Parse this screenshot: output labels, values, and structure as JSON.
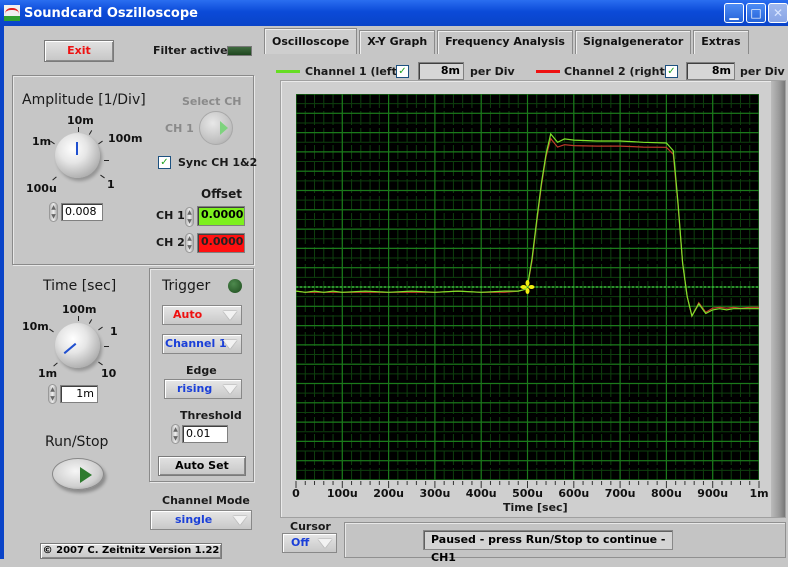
{
  "window": {
    "title": "Soundcard Oszilloscope",
    "controls": [
      "minimize",
      "maximize",
      "close"
    ]
  },
  "left_panel": {
    "exit_label": "Exit",
    "filter_active_label": "Filter active",
    "amplitude": {
      "title": "Amplitude [1/Div]",
      "knob_scale": [
        "100u",
        "1m",
        "10m",
        "100m",
        "1"
      ],
      "value": "0.008"
    },
    "select_ch": {
      "label": "Select CH",
      "value": "CH 1"
    },
    "sync_label": "Sync CH 1&2",
    "sync_checked": true,
    "offset": {
      "title": "Offset",
      "ch1_label": "CH 1",
      "ch1_value": "0.0000",
      "ch2_label": "CH 2",
      "ch2_value": "0.0000"
    },
    "time": {
      "title": "Time [sec]",
      "knob_scale": [
        "1m",
        "10m",
        "100m",
        "1",
        "10"
      ],
      "value": "1m"
    },
    "trigger": {
      "title": "Trigger",
      "mode": "Auto",
      "source": "Channel 1",
      "edge_label": "Edge",
      "edge": "rising",
      "threshold_label": "Threshold",
      "threshold": "0.01",
      "autoset_label": "Auto Set"
    },
    "run_stop_label": "Run/Stop",
    "channel_mode_label": "Channel Mode",
    "channel_mode": "single",
    "copyright": "© 2007   C. Zeitnitz Version 1.22"
  },
  "tabs": [
    {
      "label": "Oscilloscope",
      "active": true
    },
    {
      "label": "X-Y Graph",
      "active": false
    },
    {
      "label": "Frequency Analysis",
      "active": false
    },
    {
      "label": "Signalgenerator",
      "active": false
    },
    {
      "label": "Extras",
      "active": false
    }
  ],
  "channels": [
    {
      "name": "Channel 1 (left)",
      "color": "#66dd22",
      "enabled": true,
      "per_div": "8m",
      "per_div_label": "per Div"
    },
    {
      "name": "Channel 2 (right)",
      "color": "#ee1111",
      "enabled": true,
      "per_div": "8m",
      "per_div_label": "per Div"
    }
  ],
  "cursor": {
    "label": "Cursor",
    "value": "Off"
  },
  "status": "Paused - press Run/Stop to continue - CH1",
  "colors": {
    "plot_bg": "#000000",
    "grid_major": "#1b7a1b",
    "grid_minor": "#0e3f0e",
    "trigger_line": "#3cb43c",
    "trigger_marker": "#f2ee10",
    "ch1": "#7ee22a",
    "ch2": "#c03a2a"
  },
  "chart_data": {
    "type": "line",
    "title": "",
    "xlabel": "Time [sec]",
    "ylabel": "",
    "x_unit": "s",
    "xlim": [
      0,
      0.001
    ],
    "x_ticks": [
      "0",
      "100u",
      "200u",
      "300u",
      "400u",
      "500u",
      "600u",
      "700u",
      "800u",
      "900u",
      "1m"
    ],
    "y_per_div": 0.008,
    "y_divisions": 20,
    "ylim": [
      -0.08,
      0.08
    ],
    "grid": true,
    "trigger_level": 0.0,
    "trigger_point": [
      0.0005,
      0.0
    ],
    "x_us": [
      0,
      20,
      40,
      60,
      80,
      100,
      150,
      200,
      250,
      300,
      350,
      400,
      450,
      480,
      495,
      500,
      510,
      520,
      530,
      540,
      550,
      565,
      580,
      600,
      650,
      700,
      750,
      800,
      815,
      825,
      835,
      845,
      855,
      870,
      885,
      900,
      915,
      930,
      945,
      960,
      980,
      1000
    ],
    "series": [
      {
        "name": "Channel 1 (left)",
        "values_mV": [
          -1.7,
          -2.2,
          -1.7,
          -2.2,
          -1.7,
          -2.2,
          -1.7,
          -2.2,
          -1.7,
          -2.2,
          -1.7,
          -2.2,
          -1.7,
          -1.7,
          -1.0,
          0.4,
          12.0,
          28.0,
          43.0,
          55.0,
          63.4,
          60.0,
          61.4,
          60.9,
          60.5,
          60.5,
          60.0,
          59.7,
          56.5,
          35.0,
          10.0,
          -4.0,
          -12.0,
          -7.0,
          -11.0,
          -9.5,
          -9.0,
          -9.5,
          -9.0,
          -9.0,
          -9.0,
          -9.0
        ]
      },
      {
        "name": "Channel 2 (right)",
        "values_mV": [
          -1.7,
          -2.2,
          -2.2,
          -2.2,
          -2.2,
          -2.2,
          -2.2,
          -2.2,
          -2.2,
          -2.2,
          -1.7,
          -2.2,
          -2.2,
          -1.7,
          -1.0,
          0.4,
          11.0,
          27.0,
          42.0,
          54.0,
          61.5,
          58.0,
          59.0,
          58.6,
          58.4,
          58.4,
          58.0,
          57.9,
          55.0,
          34.0,
          10.0,
          -4.0,
          -12.0,
          -6.5,
          -10.5,
          -8.8,
          -8.4,
          -8.8,
          -8.4,
          -8.8,
          -8.4,
          -8.4
        ]
      }
    ]
  }
}
